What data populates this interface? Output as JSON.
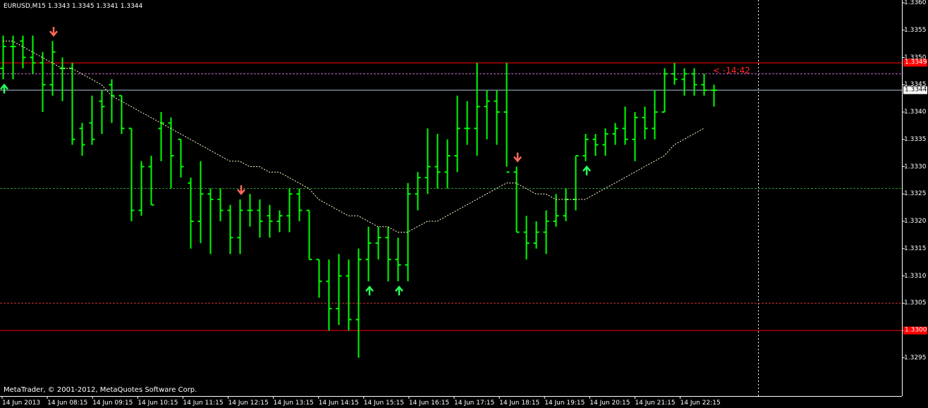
{
  "chart": {
    "symbol_header": "EURUSD,M15  1.3343 1.3345 1.3341 1.3344",
    "copyright": "MetaTrader, © 2001-2012, MetaQuotes Software Corp.",
    "countdown": "< -14:42"
  },
  "colors": {
    "background": "#000000",
    "bars": "#00ff00",
    "ma_line": "#ffffcc",
    "sell_arrow": "#ff6a5a",
    "buy_arrow": "#2aff5a",
    "red_level": "#ff0000",
    "magenta_level": "#cc66cc",
    "dashed_red_level": "#cc3333",
    "dashed_green_level": "#2a8f2a",
    "current_price_line": "#b0c4de",
    "axis": "#ffffff"
  },
  "price_axis": {
    "labels": [
      "1.3360",
      "1.3355",
      "1.3350",
      "1.3345",
      "1.3340",
      "1.3335",
      "1.3330",
      "1.3325",
      "1.3320",
      "1.3315",
      "1.3310",
      "1.3305",
      "1.3300",
      "1.3295"
    ]
  },
  "price_tags": {
    "upper_level": "1.3349",
    "current_bid": "1.3344",
    "lower_level": "1.3300"
  },
  "time_axis": {
    "labels": [
      "14 Jun 2013",
      "14 Jun 08:15",
      "14 Jun 09:15",
      "14 Jun 10:15",
      "14 Jun 11:15",
      "14 Jun 12:15",
      "14 Jun 13:15",
      "14 Jun 14:15",
      "14 Jun 15:15",
      "14 Jun 16:15",
      "14 Jun 17:15",
      "14 Jun 18:15",
      "14 Jun 19:15",
      "14 Jun 20:15",
      "14 Jun 21:15",
      "14 Jun 22:15"
    ]
  },
  "chart_data": {
    "type": "ohlc",
    "series_levels": {
      "red_solid": [
        1.3349,
        1.33
      ],
      "magenta_dashed": 1.3347,
      "red_dashed": 1.3305,
      "green_dashed": 1.3326,
      "current_price": 1.3344
    },
    "bars": [
      [
        1.3348,
        1.3354,
        1.3346,
        1.3352
      ],
      [
        1.3352,
        1.3354,
        1.3346,
        1.3352
      ],
      [
        1.3353,
        1.3354,
        1.3348,
        1.335
      ],
      [
        1.335,
        1.3354,
        1.3347,
        1.3349
      ],
      [
        1.3349,
        1.3351,
        1.334,
        1.3345
      ],
      [
        1.3345,
        1.3353,
        1.3343,
        1.3351
      ],
      [
        1.3348,
        1.335,
        1.3342,
        1.3348
      ],
      [
        1.3348,
        1.3349,
        1.3334,
        1.3335
      ],
      [
        1.3337,
        1.3338,
        1.3332,
        1.3334
      ],
      [
        1.3338,
        1.3343,
        1.3334,
        1.3335
      ],
      [
        1.3342,
        1.3344,
        1.3336,
        1.3341
      ],
      [
        1.3345,
        1.3346,
        1.3338,
        1.3343
      ],
      [
        1.3343,
        1.3343,
        1.3336,
        1.3337
      ],
      [
        1.3337,
        1.3337,
        1.332,
        1.3322
      ],
      [
        1.3322,
        1.3331,
        1.3321,
        1.333
      ],
      [
        1.333,
        1.3332,
        1.3323,
        1.3323
      ],
      [
        1.3337,
        1.334,
        1.3331,
        1.3338
      ],
      [
        1.3338,
        1.3339,
        1.3326,
        1.3332
      ],
      [
        1.3335,
        1.3335,
        1.3328,
        1.333
      ],
      [
        1.3327,
        1.3328,
        1.3315,
        1.332
      ],
      [
        1.332,
        1.3331,
        1.3316,
        1.3325
      ],
      [
        1.3325,
        1.3326,
        1.3314,
        1.3324
      ],
      [
        1.3324,
        1.3326,
        1.332,
        1.3322
      ],
      [
        1.3322,
        1.3323,
        1.3314,
        1.3317
      ],
      [
        1.3317,
        1.3324,
        1.3314,
        1.3322
      ],
      [
        1.3322,
        1.3325,
        1.3319,
        1.3322
      ],
      [
        1.3322,
        1.3324,
        1.3317,
        1.332
      ],
      [
        1.3321,
        1.3323,
        1.3317,
        1.332
      ],
      [
        1.332,
        1.3322,
        1.3318,
        1.3321
      ],
      [
        1.3321,
        1.3326,
        1.3318,
        1.3325
      ],
      [
        1.3325,
        1.3326,
        1.332,
        1.3322
      ],
      [
        1.3322,
        1.3322,
        1.3313,
        1.3313
      ],
      [
        1.3313,
        1.3313,
        1.3306,
        1.3309
      ],
      [
        1.3309,
        1.3313,
        1.33,
        1.3304
      ],
      [
        1.3304,
        1.3314,
        1.3301,
        1.331
      ],
      [
        1.331,
        1.3313,
        1.33,
        1.3302
      ],
      [
        1.3302,
        1.3315,
        1.3295,
        1.3313
      ],
      [
        1.3313,
        1.3319,
        1.3309,
        1.3316
      ],
      [
        1.3316,
        1.3319,
        1.3313,
        1.3317
      ],
      [
        1.3317,
        1.3319,
        1.3309,
        1.3313
      ],
      [
        1.3313,
        1.3317,
        1.3309,
        1.3312
      ],
      [
        1.3312,
        1.3327,
        1.3309,
        1.3325
      ],
      [
        1.3325,
        1.3329,
        1.3322,
        1.3328
      ],
      [
        1.3328,
        1.3337,
        1.3325,
        1.333
      ],
      [
        1.333,
        1.3336,
        1.3326,
        1.3329
      ],
      [
        1.3329,
        1.3335,
        1.3326,
        1.3332
      ],
      [
        1.3332,
        1.3343,
        1.3329,
        1.3337
      ],
      [
        1.3337,
        1.3342,
        1.3334,
        1.3337
      ],
      [
        1.3337,
        1.3349,
        1.3332,
        1.3341
      ],
      [
        1.3341,
        1.3344,
        1.3335,
        1.3342
      ],
      [
        1.3342,
        1.3344,
        1.3334,
        1.334
      ],
      [
        1.334,
        1.3349,
        1.333,
        1.3329
      ],
      [
        1.3329,
        1.333,
        1.3318,
        1.3318
      ],
      [
        1.3318,
        1.3321,
        1.3313,
        1.3316
      ],
      [
        1.3316,
        1.332,
        1.3315,
        1.3318
      ],
      [
        1.3318,
        1.3322,
        1.3314,
        1.332
      ],
      [
        1.332,
        1.3325,
        1.3319,
        1.3321
      ],
      [
        1.3321,
        1.3326,
        1.332,
        1.3324
      ],
      [
        1.3324,
        1.3332,
        1.3322,
        1.3332
      ],
      [
        1.3332,
        1.3336,
        1.3331,
        1.3335
      ],
      [
        1.3335,
        1.3336,
        1.3332,
        1.3334
      ],
      [
        1.3334,
        1.3337,
        1.3332,
        1.3336
      ],
      [
        1.3336,
        1.3338,
        1.3334,
        1.3337
      ],
      [
        1.3337,
        1.3341,
        1.3334,
        1.3335
      ],
      [
        1.3335,
        1.334,
        1.3331,
        1.3339
      ],
      [
        1.3339,
        1.3341,
        1.3335,
        1.3337
      ],
      [
        1.3337,
        1.3344,
        1.3335,
        1.334
      ],
      [
        1.334,
        1.3348,
        1.334,
        1.3347
      ],
      [
        1.3347,
        1.3349,
        1.3345,
        1.3346
      ],
      [
        1.3346,
        1.3348,
        1.3343,
        1.3347
      ],
      [
        1.3347,
        1.3348,
        1.3343,
        1.3345
      ],
      [
        1.3345,
        1.3347,
        1.3343,
        1.3344
      ],
      [
        1.3344,
        1.3345,
        1.3341,
        1.3344
      ]
    ],
    "moving_average": [
      1.3353,
      1.3353,
      1.3352,
      1.3351,
      1.335,
      1.3349,
      1.3348,
      1.3348,
      1.3347,
      1.3346,
      1.3345,
      1.3343,
      1.3342,
      1.3341,
      1.334,
      1.3339,
      1.3338,
      1.3337,
      1.3336,
      1.3335,
      1.3334,
      1.3333,
      1.3332,
      1.3331,
      1.3331,
      1.333,
      1.333,
      1.3329,
      1.3329,
      1.3328,
      1.3327,
      1.3326,
      1.3324,
      1.3323,
      1.3322,
      1.3321,
      1.3321,
      1.332,
      1.3319,
      1.3319,
      1.3318,
      1.3318,
      1.3319,
      1.332,
      1.332,
      1.3321,
      1.3322,
      1.3323,
      1.3324,
      1.3325,
      1.3326,
      1.3327,
      1.3327,
      1.3326,
      1.3325,
      1.3325,
      1.3324,
      1.3324,
      1.3324,
      1.3324,
      1.3325,
      1.3326,
      1.3327,
      1.3328,
      1.3329,
      1.333,
      1.3331,
      1.3332,
      1.3334,
      1.3335,
      1.3336,
      1.3337
    ],
    "signals": [
      {
        "type": "sell",
        "bar": 5
      },
      {
        "type": "buy",
        "bar": 0
      },
      {
        "type": "sell",
        "bar": 24
      },
      {
        "type": "buy",
        "bar": 37
      },
      {
        "type": "buy",
        "bar": 40
      },
      {
        "type": "sell",
        "bar": 52
      },
      {
        "type": "buy",
        "bar": 59
      }
    ]
  }
}
